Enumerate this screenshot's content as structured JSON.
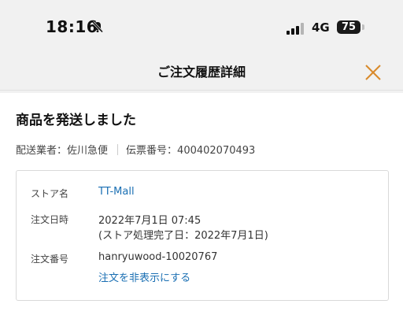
{
  "status_bar": {
    "time": "18:16",
    "network": "4G",
    "battery": "75",
    "icons": [
      "bell-slash-icon",
      "signal-icon"
    ]
  },
  "nav": {
    "title": "ご注文履歴詳細",
    "close_icon": "close-icon",
    "accent_color": "#d98a2b"
  },
  "order": {
    "heading": "商品を発送しました",
    "carrier_label": "配送業者：",
    "carrier": "佐川急便",
    "tracking_label": "伝票番号：",
    "tracking_number": "400402070493",
    "details": {
      "store_label": "ストア名",
      "store_name": "TT-Mall",
      "date_label": "注文日時",
      "date_value": "2022年7月1日 07:45",
      "date_note": "(ストア処理完了日：2022年7月1日)",
      "number_label": "注文番号",
      "number_value": "hanryuwood-10020767",
      "hide_link": "注文を非表示にする"
    }
  },
  "colors": {
    "link": "#1a6fb3",
    "background": "#f1f1f1"
  }
}
